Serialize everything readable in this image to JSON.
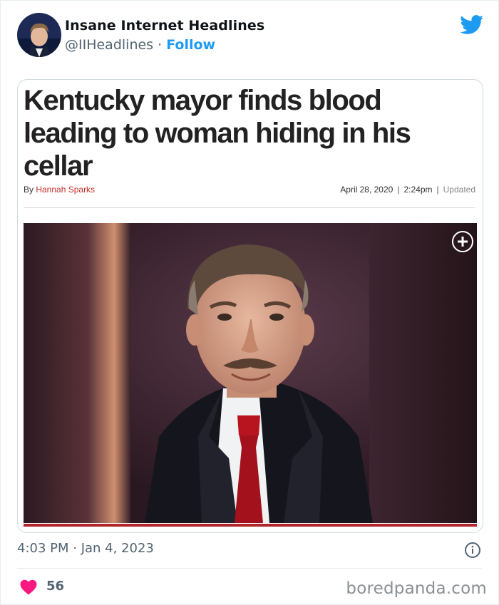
{
  "tweet": {
    "display_name": "Insane Internet Headlines",
    "handle": "@IIHeadlines",
    "separator": " · ",
    "follow_label": "Follow",
    "timestamp": "4:03 PM · Jan 4, 2023",
    "like_count": "56",
    "icons": {
      "brand": "twitter-bird-icon",
      "info": "info-icon",
      "like": "heart-icon",
      "photo_expand": "plus-icon"
    },
    "colors": {
      "link": "#1d9bf0",
      "heart": "#f91880",
      "muted": "#536471",
      "bird": "#1d9bf0"
    }
  },
  "article": {
    "headline": "Kentucky mayor finds blood leading to woman hiding in his cellar",
    "byline_prefix": "By ",
    "author": "Hannah Sparks",
    "date": "April 28, 2020",
    "time": "2:24pm",
    "updated_label": "Updated",
    "meta_separator": "|",
    "colors": {
      "author": "#c4302b",
      "photo_rule": "#b1262b"
    }
  },
  "watermark": "boredpanda.com"
}
